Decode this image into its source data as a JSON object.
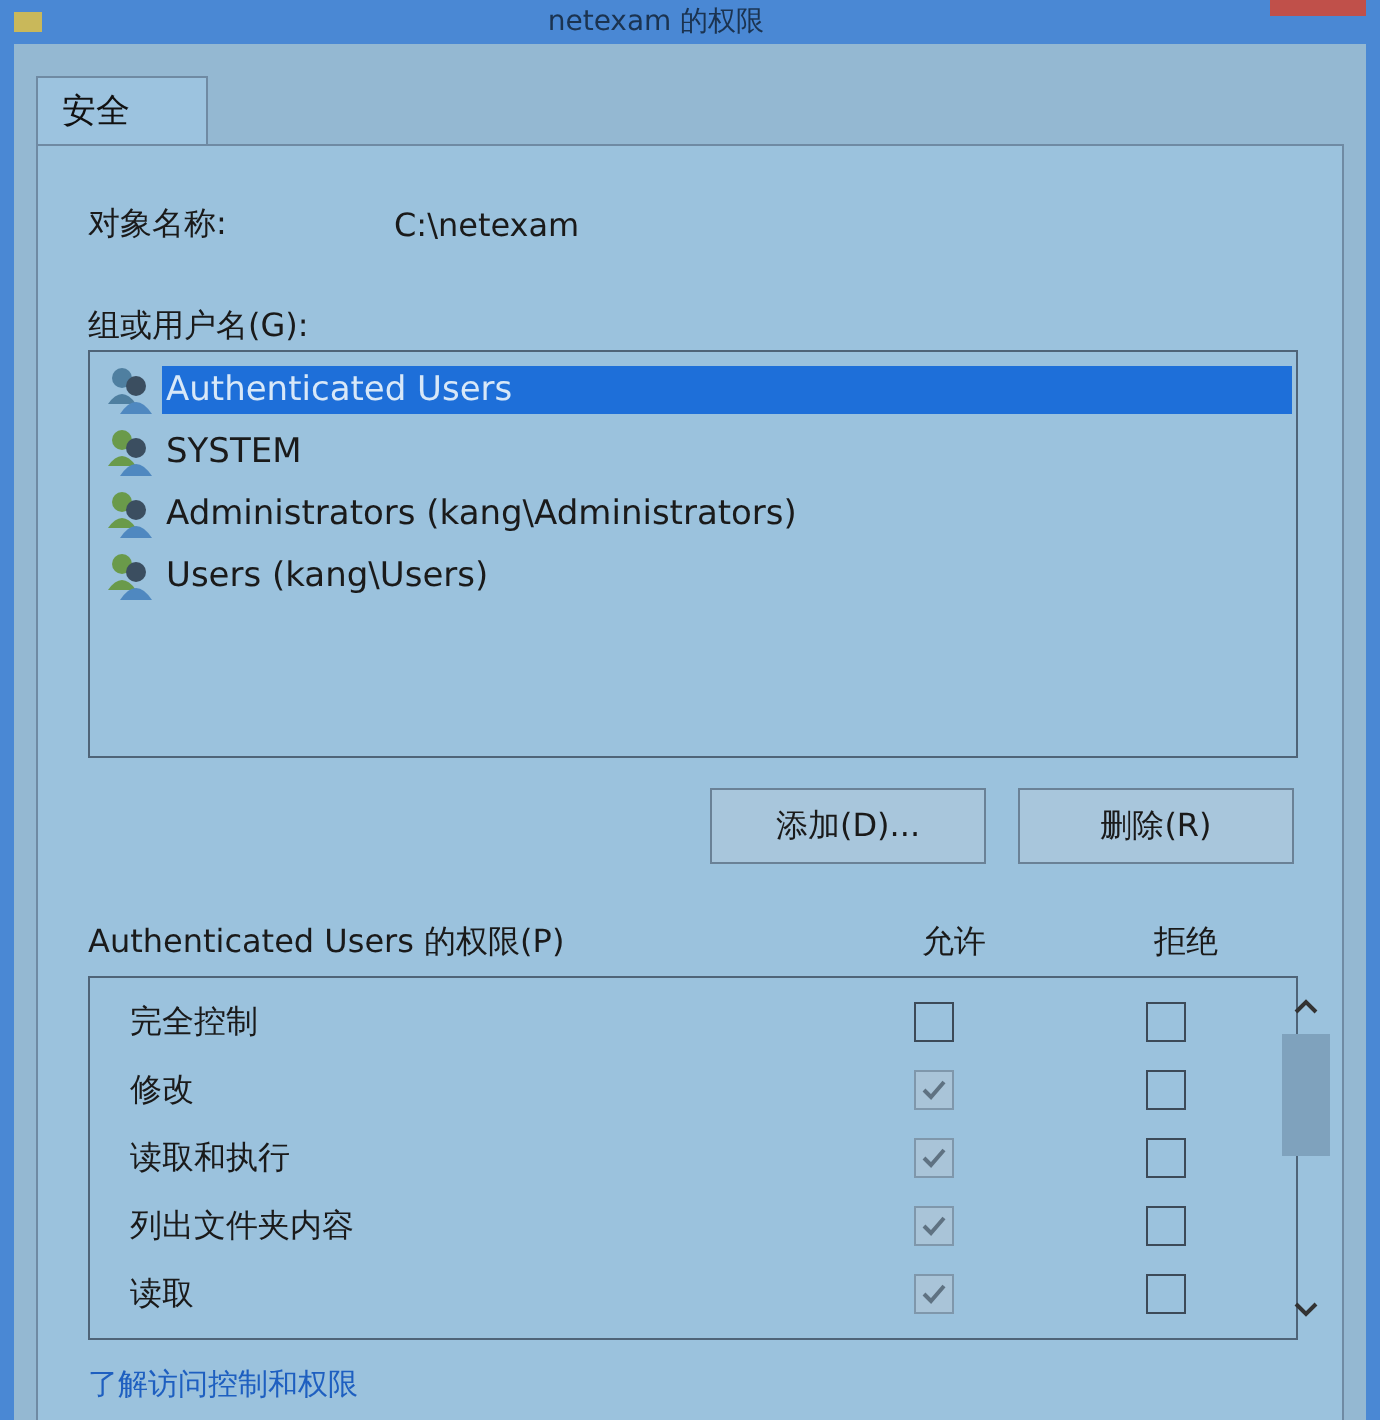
{
  "window": {
    "title": "netexam 的权限"
  },
  "tabs": [
    {
      "label": "安全",
      "selected": true
    }
  ],
  "object_name": {
    "label": "对象名称:",
    "value": "C:\\netexam"
  },
  "groups": {
    "label": "组或用户名(G):",
    "items": [
      {
        "name": "Authenticated Users",
        "selected": true
      },
      {
        "name": "SYSTEM",
        "selected": false
      },
      {
        "name": "Administrators (kang\\Administrators)",
        "selected": false
      },
      {
        "name": "Users (kang\\Users)",
        "selected": false
      }
    ]
  },
  "buttons": [
    "添加(D)...",
    "删除(R)"
  ],
  "permissions": {
    "label": "Authenticated Users 的权限(P)",
    "allow_header": "允许",
    "deny_header": "拒绝",
    "rows": [
      {
        "name": "完全控制",
        "allow": {
          "checked": false,
          "disabled": false
        },
        "deny": {
          "checked": false,
          "disabled": false
        }
      },
      {
        "name": "修改",
        "allow": {
          "checked": true,
          "disabled": true
        },
        "deny": {
          "checked": false,
          "disabled": false
        }
      },
      {
        "name": "读取和执行",
        "allow": {
          "checked": true,
          "disabled": true
        },
        "deny": {
          "checked": false,
          "disabled": false
        }
      },
      {
        "name": "列出文件夹内容",
        "allow": {
          "checked": true,
          "disabled": true
        },
        "deny": {
          "checked": false,
          "disabled": false
        }
      },
      {
        "name": "读取",
        "allow": {
          "checked": true,
          "disabled": true
        },
        "deny": {
          "checked": false,
          "disabled": false
        }
      }
    ]
  },
  "link": "了解访问控制和权限"
}
